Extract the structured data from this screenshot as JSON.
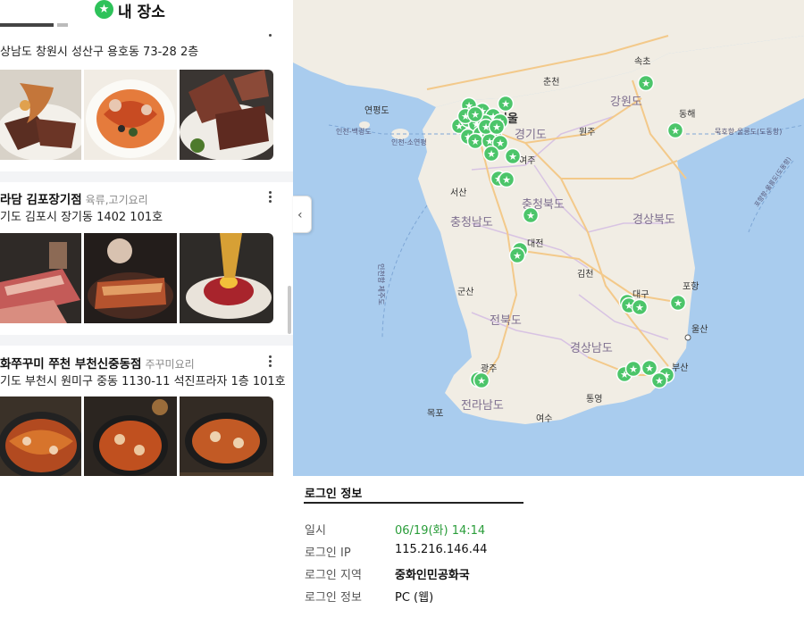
{
  "panel": {
    "title": "내 장소",
    "places": [
      {
        "name": "",
        "category": "",
        "address": "상남도 창원시 성산구 용호동 73-28 2층"
      },
      {
        "name": "라담 김포장기점",
        "category": "육류,고기요리",
        "address": "기도 김포시 장기동 1402 101호"
      },
      {
        "name": "화쭈꾸미 쭈천 부천신중동점",
        "category": "주꾸미요리",
        "address": "기도 부천시 원미구 중동 1130-11 석진프라자 1층 101호"
      }
    ]
  },
  "map": {
    "labels": {
      "seoul": "서울",
      "chuncheon": "춘천",
      "sokcho": "속초",
      "gangwon": "강원도",
      "donghae": "동해",
      "yeonpyeong": "연평도",
      "gyeonggi": "경기도",
      "wonju": "원주",
      "incheon_baengnyeong": "인천-백령도",
      "incheon_soyeon": "인천-소연평",
      "yeoju": "여주",
      "mukho_ulleung": "묵호항-울릉도(도동항)",
      "seosan": "서산",
      "chungbuk": "충청북도",
      "gyeongbuk": "경상북도",
      "chungnam": "충청남도",
      "daejeon": "대전",
      "incheon_jeju": "인천항 제주도",
      "gimcheon": "김천",
      "gunsan": "군산",
      "daegu": "대구",
      "pohang": "포항",
      "jeonbuk": "전북도",
      "ulsan": "울산",
      "gyeongnam": "경상남도",
      "gwangju": "광주",
      "busan": "부산",
      "tongyeong": "통영",
      "jeonnam": "전라남도",
      "mokpo": "목포",
      "yeosu": "여수",
      "port_route": "포항항-울릉도(도동항)"
    },
    "marker_icon": "star-marker-icon",
    "marker_color": "#4cc56a"
  },
  "login": {
    "heading": "로그인 정보",
    "rows": [
      {
        "key": "일시",
        "value": "06/19(화) 14:14"
      },
      {
        "key": "로그인 IP",
        "value": "115.216.146.44"
      },
      {
        "key": "로그인 지역",
        "value": "중화인민공화국"
      },
      {
        "key": "로그인 정보",
        "value": "PC (웹)"
      }
    ]
  },
  "colors": {
    "accent_green": "#2ec25a",
    "time_green": "#2a9d3a",
    "sea": "#a9ccee",
    "land": "#f1ede4"
  }
}
